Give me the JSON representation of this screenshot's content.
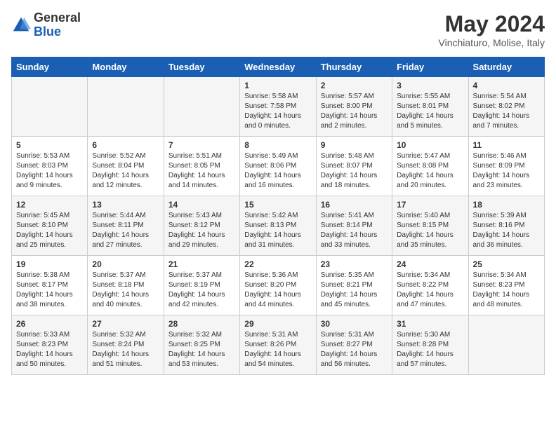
{
  "logo": {
    "general": "General",
    "blue": "Blue"
  },
  "title": "May 2024",
  "location": "Vinchiaturo, Molise, Italy",
  "days_of_week": [
    "Sunday",
    "Monday",
    "Tuesday",
    "Wednesday",
    "Thursday",
    "Friday",
    "Saturday"
  ],
  "weeks": [
    [
      {
        "day": "",
        "content": ""
      },
      {
        "day": "",
        "content": ""
      },
      {
        "day": "",
        "content": ""
      },
      {
        "day": "1",
        "content": "Sunrise: 5:58 AM\nSunset: 7:58 PM\nDaylight: 14 hours\nand 0 minutes."
      },
      {
        "day": "2",
        "content": "Sunrise: 5:57 AM\nSunset: 8:00 PM\nDaylight: 14 hours\nand 2 minutes."
      },
      {
        "day": "3",
        "content": "Sunrise: 5:55 AM\nSunset: 8:01 PM\nDaylight: 14 hours\nand 5 minutes."
      },
      {
        "day": "4",
        "content": "Sunrise: 5:54 AM\nSunset: 8:02 PM\nDaylight: 14 hours\nand 7 minutes."
      }
    ],
    [
      {
        "day": "5",
        "content": "Sunrise: 5:53 AM\nSunset: 8:03 PM\nDaylight: 14 hours\nand 9 minutes."
      },
      {
        "day": "6",
        "content": "Sunrise: 5:52 AM\nSunset: 8:04 PM\nDaylight: 14 hours\nand 12 minutes."
      },
      {
        "day": "7",
        "content": "Sunrise: 5:51 AM\nSunset: 8:05 PM\nDaylight: 14 hours\nand 14 minutes."
      },
      {
        "day": "8",
        "content": "Sunrise: 5:49 AM\nSunset: 8:06 PM\nDaylight: 14 hours\nand 16 minutes."
      },
      {
        "day": "9",
        "content": "Sunrise: 5:48 AM\nSunset: 8:07 PM\nDaylight: 14 hours\nand 18 minutes."
      },
      {
        "day": "10",
        "content": "Sunrise: 5:47 AM\nSunset: 8:08 PM\nDaylight: 14 hours\nand 20 minutes."
      },
      {
        "day": "11",
        "content": "Sunrise: 5:46 AM\nSunset: 8:09 PM\nDaylight: 14 hours\nand 23 minutes."
      }
    ],
    [
      {
        "day": "12",
        "content": "Sunrise: 5:45 AM\nSunset: 8:10 PM\nDaylight: 14 hours\nand 25 minutes."
      },
      {
        "day": "13",
        "content": "Sunrise: 5:44 AM\nSunset: 8:11 PM\nDaylight: 14 hours\nand 27 minutes."
      },
      {
        "day": "14",
        "content": "Sunrise: 5:43 AM\nSunset: 8:12 PM\nDaylight: 14 hours\nand 29 minutes."
      },
      {
        "day": "15",
        "content": "Sunrise: 5:42 AM\nSunset: 8:13 PM\nDaylight: 14 hours\nand 31 minutes."
      },
      {
        "day": "16",
        "content": "Sunrise: 5:41 AM\nSunset: 8:14 PM\nDaylight: 14 hours\nand 33 minutes."
      },
      {
        "day": "17",
        "content": "Sunrise: 5:40 AM\nSunset: 8:15 PM\nDaylight: 14 hours\nand 35 minutes."
      },
      {
        "day": "18",
        "content": "Sunrise: 5:39 AM\nSunset: 8:16 PM\nDaylight: 14 hours\nand 36 minutes."
      }
    ],
    [
      {
        "day": "19",
        "content": "Sunrise: 5:38 AM\nSunset: 8:17 PM\nDaylight: 14 hours\nand 38 minutes."
      },
      {
        "day": "20",
        "content": "Sunrise: 5:37 AM\nSunset: 8:18 PM\nDaylight: 14 hours\nand 40 minutes."
      },
      {
        "day": "21",
        "content": "Sunrise: 5:37 AM\nSunset: 8:19 PM\nDaylight: 14 hours\nand 42 minutes."
      },
      {
        "day": "22",
        "content": "Sunrise: 5:36 AM\nSunset: 8:20 PM\nDaylight: 14 hours\nand 44 minutes."
      },
      {
        "day": "23",
        "content": "Sunrise: 5:35 AM\nSunset: 8:21 PM\nDaylight: 14 hours\nand 45 minutes."
      },
      {
        "day": "24",
        "content": "Sunrise: 5:34 AM\nSunset: 8:22 PM\nDaylight: 14 hours\nand 47 minutes."
      },
      {
        "day": "25",
        "content": "Sunrise: 5:34 AM\nSunset: 8:23 PM\nDaylight: 14 hours\nand 48 minutes."
      }
    ],
    [
      {
        "day": "26",
        "content": "Sunrise: 5:33 AM\nSunset: 8:23 PM\nDaylight: 14 hours\nand 50 minutes."
      },
      {
        "day": "27",
        "content": "Sunrise: 5:32 AM\nSunset: 8:24 PM\nDaylight: 14 hours\nand 51 minutes."
      },
      {
        "day": "28",
        "content": "Sunrise: 5:32 AM\nSunset: 8:25 PM\nDaylight: 14 hours\nand 53 minutes."
      },
      {
        "day": "29",
        "content": "Sunrise: 5:31 AM\nSunset: 8:26 PM\nDaylight: 14 hours\nand 54 minutes."
      },
      {
        "day": "30",
        "content": "Sunrise: 5:31 AM\nSunset: 8:27 PM\nDaylight: 14 hours\nand 56 minutes."
      },
      {
        "day": "31",
        "content": "Sunrise: 5:30 AM\nSunset: 8:28 PM\nDaylight: 14 hours\nand 57 minutes."
      },
      {
        "day": "",
        "content": ""
      }
    ]
  ]
}
